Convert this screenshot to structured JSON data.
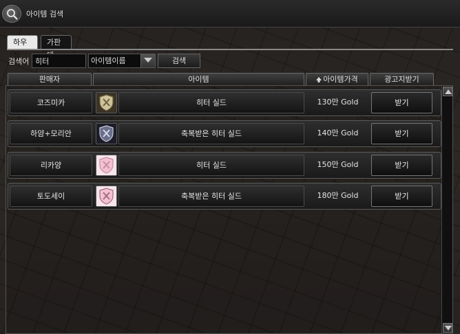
{
  "window": {
    "title": "아이템 검색",
    "icon": "search-icon"
  },
  "tabs": [
    {
      "label": "하우징",
      "active": true
    },
    {
      "label": "가판대",
      "active": false
    }
  ],
  "search": {
    "label": "검색어",
    "value": "히터",
    "category_selected": "아이템이름",
    "button_label": "검색"
  },
  "columns": {
    "seller": "판매자",
    "item": "아이템",
    "price": "아이템가격",
    "price_sort_icon": "arrow-up-icon",
    "ad": "광고지받기"
  },
  "rows": [
    {
      "seller": "코즈미카",
      "item": "히터 실드",
      "price": "130만 Gold",
      "button": "받기",
      "icon_color": "#cfc39a"
    },
    {
      "seller": "하얌+모리안",
      "item": "축복받은 히터 실드",
      "price": "140만 Gold",
      "button": "받기",
      "icon_color": "#6a6f8a"
    },
    {
      "seller": "리카양",
      "item": "히터 실드",
      "price": "150만 Gold",
      "button": "받기",
      "icon_color": "#f2c2d2"
    },
    {
      "seller": "토도세이",
      "item": "축복받은 히터 실드",
      "price": "180만 Gold",
      "button": "받기",
      "icon_color": "#f2c2d2"
    }
  ],
  "colors": {
    "panel_bg": "#1a1a1a",
    "border": "#6a6a6a",
    "text": "#e6e6e6"
  }
}
